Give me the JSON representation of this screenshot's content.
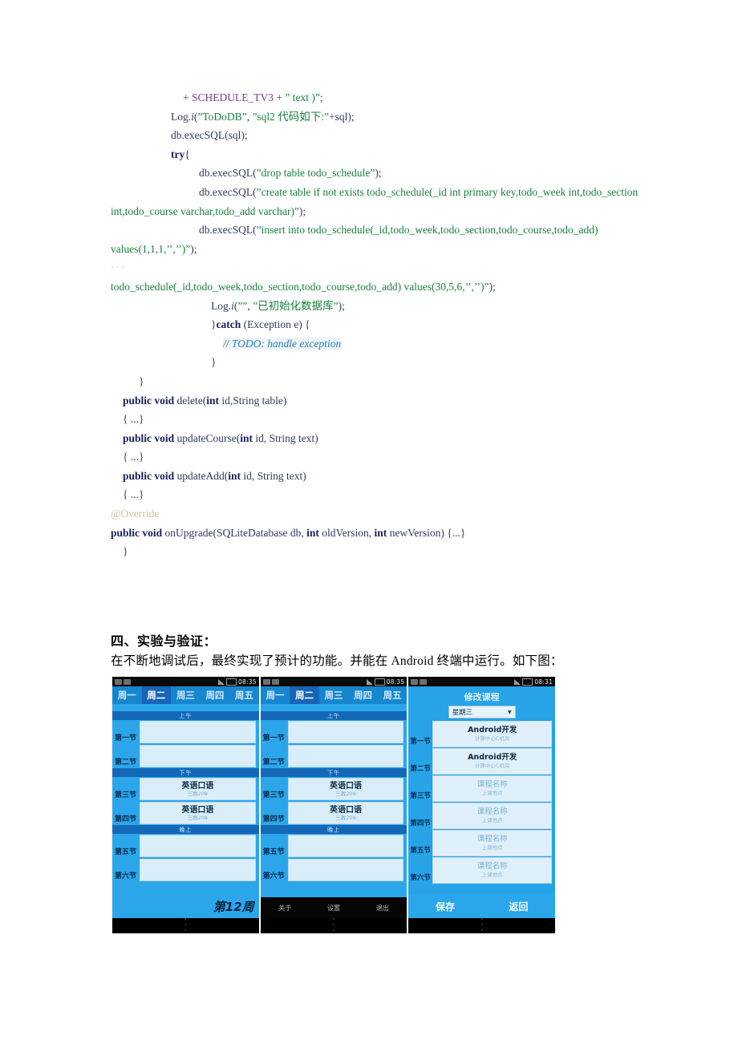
{
  "document": {
    "code_lines": [
      {
        "indent": 90,
        "parts": [
          {
            "t": "+ ",
            "c": "pln"
          },
          {
            "t": "SCHEDULE_TV3",
            "c": "cls"
          },
          {
            "t": " + ",
            "c": "pln"
          },
          {
            "t": "” text )”",
            "c": "str"
          },
          {
            "t": ";",
            "c": "pln"
          }
        ]
      },
      {
        "indent": 75,
        "parts": [
          {
            "t": "Log.",
            "c": "pln"
          },
          {
            "t": "i",
            "c": "mtd"
          },
          {
            "t": "(",
            "c": "pln"
          },
          {
            "t": "”ToDoDB”",
            "c": "str"
          },
          {
            "t": ", ",
            "c": "pln"
          },
          {
            "t": "”sql2 代码如下:”",
            "c": "str"
          },
          {
            "t": "+sql);",
            "c": "pln"
          }
        ]
      },
      {
        "indent": 75,
        "parts": [
          {
            "t": "db.execSQL(sql);",
            "c": "pln"
          }
        ]
      },
      {
        "indent": 75,
        "parts": [
          {
            "t": "try",
            "c": "kw"
          },
          {
            "t": "{",
            "c": "pln"
          }
        ]
      },
      {
        "indent": 110,
        "parts": [
          {
            "t": "db.execSQL(",
            "c": "pln"
          },
          {
            "t": "”drop table todo_schedule”",
            "c": "str"
          },
          {
            "t": ");",
            "c": "pln"
          }
        ]
      },
      {
        "indent": 110,
        "parts": [
          {
            "t": "db.execSQL(",
            "c": "pln"
          },
          {
            "t": "”create table if not exists todo_schedule(_id int primary key,todo_week int,todo_section int,todo_course varchar,todo_add varchar)”",
            "c": "str"
          },
          {
            "t": ");",
            "c": "pln"
          }
        ]
      },
      {
        "indent": 110,
        "parts": [
          {
            "t": "db.execSQL(",
            "c": "pln"
          },
          {
            "t": "”insert into todo_schedule(_id,todo_week,todo_section,todo_course,todo_add) values(1,1,1,’’,’’)”",
            "c": "str"
          },
          {
            "t": ");",
            "c": "pln"
          }
        ]
      },
      {
        "indent": 0,
        "parts": [
          {
            "t": "···",
            "c": "dots"
          }
        ]
      },
      {
        "indent": 0,
        "parts": [
          {
            "t": "todo_schedule(_id,todo_week,todo_section,todo_course,todo_add) values(30,5,6,’’,’’)”",
            "c": "str"
          },
          {
            "t": ");",
            "c": "pln"
          }
        ]
      },
      {
        "indent": 125,
        "parts": [
          {
            "t": "Log.",
            "c": "pln"
          },
          {
            "t": "i",
            "c": "mtd"
          },
          {
            "t": "(",
            "c": "pln"
          },
          {
            "t": "””",
            "c": "str"
          },
          {
            "t": ", ",
            "c": "pln"
          },
          {
            "t": "”已初始化数据库”",
            "c": "str"
          },
          {
            "t": ");",
            "c": "pln"
          }
        ]
      },
      {
        "indent": 125,
        "parts": [
          {
            "t": "}",
            "c": "pln"
          },
          {
            "t": "catch",
            "c": "kw"
          },
          {
            "t": " (Exception e) {",
            "c": "pln"
          }
        ]
      },
      {
        "indent": 140,
        "parts": [
          {
            "t": "// TODO: handle exception",
            "c": "cmt"
          }
        ]
      },
      {
        "indent": 125,
        "parts": [
          {
            "t": "}",
            "c": "pln"
          }
        ]
      },
      {
        "indent": 35,
        "parts": [
          {
            "t": "}",
            "c": "pln"
          }
        ]
      },
      {
        "indent": 15,
        "parts": [
          {
            "t": "public void",
            "c": "kw"
          },
          {
            "t": " delete(",
            "c": "pln"
          },
          {
            "t": "int",
            "c": "kw"
          },
          {
            "t": " id,String table)",
            "c": "pln"
          }
        ]
      },
      {
        "indent": 15,
        "parts": [
          {
            "t": "{ ...}",
            "c": "pln"
          }
        ]
      },
      {
        "indent": 15,
        "parts": [
          {
            "t": "public void",
            "c": "kw"
          },
          {
            "t": " updateCourse(",
            "c": "pln"
          },
          {
            "t": "int",
            "c": "kw"
          },
          {
            "t": " id, String text)",
            "c": "pln"
          }
        ]
      },
      {
        "indent": 15,
        "parts": [
          {
            "t": "{ ...}",
            "c": "pln"
          }
        ]
      },
      {
        "indent": 15,
        "parts": [
          {
            "t": "public void",
            "c": "kw"
          },
          {
            "t": " updateAdd(",
            "c": "pln"
          },
          {
            "t": "int",
            "c": "kw"
          },
          {
            "t": " id, String text)",
            "c": "pln"
          }
        ]
      },
      {
        "indent": 15,
        "parts": [
          {
            "t": "{ ...}",
            "c": "pln"
          }
        ]
      },
      {
        "indent": 0,
        "parts": [
          {
            "t": "@Override",
            "c": "ann"
          }
        ]
      },
      {
        "indent": 0,
        "parts": [
          {
            "t": "public void",
            "c": "kw"
          },
          {
            "t": " onUpgrade(SQLiteDatabase db, ",
            "c": "pln"
          },
          {
            "t": "int",
            "c": "kw"
          },
          {
            "t": " oldVersion, ",
            "c": "pln"
          },
          {
            "t": "int",
            "c": "kw"
          },
          {
            "t": " newVersion) {...}",
            "c": "pln"
          }
        ]
      },
      {
        "indent": 15,
        "parts": [
          {
            "t": "}",
            "c": "pln"
          }
        ]
      }
    ],
    "section_heading": "四、实验与验证：",
    "body_paragraph": "在不断地调试后，最终实现了预计的功能。并能在 Android 终端中运行。如下图："
  },
  "screenshots": {
    "phone1": {
      "status_time": "08:35",
      "tabs": [
        {
          "label": "周一",
          "active": false
        },
        {
          "label": "周二",
          "active": true
        },
        {
          "label": "周三",
          "active": false
        },
        {
          "label": "周四",
          "active": false
        },
        {
          "label": "周五",
          "active": false
        }
      ],
      "periods": [
        {
          "header": "上午",
          "slots": [
            {
              "label": "第一节",
              "course": "",
              "place": ""
            },
            {
              "label": "第二节",
              "course": "",
              "place": ""
            }
          ]
        },
        {
          "header": "下午",
          "slots": [
            {
              "label": "第三节",
              "course": "英语口语",
              "place": "三教209"
            },
            {
              "label": "第四节",
              "course": "英语口语",
              "place": "三教209"
            }
          ]
        },
        {
          "header": "晚上",
          "slots": [
            {
              "label": "第五节",
              "course": "",
              "place": ""
            },
            {
              "label": "第六节",
              "course": "",
              "place": ""
            }
          ]
        }
      ],
      "week_label": "第12周"
    },
    "phone2": {
      "status_time": "08:35",
      "tabs": [
        {
          "label": "周一",
          "active": false
        },
        {
          "label": "周二",
          "active": true
        },
        {
          "label": "周三",
          "active": false
        },
        {
          "label": "周四",
          "active": false
        },
        {
          "label": "周五",
          "active": false
        }
      ],
      "periods": [
        {
          "header": "上午",
          "slots": [
            {
              "label": "第一节",
              "course": "",
              "place": ""
            },
            {
              "label": "第二节",
              "course": "",
              "place": ""
            }
          ]
        },
        {
          "header": "下午",
          "slots": [
            {
              "label": "第三节",
              "course": "英语口语",
              "place": "三教209"
            },
            {
              "label": "第四节",
              "course": "英语口语",
              "place": "三教209"
            }
          ]
        },
        {
          "header": "晚上",
          "slots": [
            {
              "label": "第五节",
              "course": "",
              "place": ""
            },
            {
              "label": "第六节",
              "course": "",
              "place": ""
            }
          ]
        }
      ],
      "menu": [
        {
          "label": "关于"
        },
        {
          "label": "设置"
        },
        {
          "label": "退出"
        }
      ]
    },
    "phone3": {
      "status_time": "08:31",
      "title": "修改课程",
      "day_selected": "星期三",
      "rows": [
        {
          "label": "第一节",
          "course": "Android开发",
          "place": "计算中心C机房",
          "placeholder": false
        },
        {
          "label": "第二节",
          "course": "Android开发",
          "place": "计算中心C机房",
          "placeholder": false
        },
        {
          "label": "第三节",
          "course": "课程名称",
          "place": "上课地点",
          "placeholder": true
        },
        {
          "label": "第四节",
          "course": "课程名称",
          "place": "上课地点",
          "placeholder": true
        },
        {
          "label": "第五节",
          "course": "课程名称",
          "place": "上课地点",
          "placeholder": true
        },
        {
          "label": "第六节",
          "course": "课程名称",
          "place": "上课地点",
          "placeholder": true
        }
      ],
      "buttons": [
        {
          "label": "保存"
        },
        {
          "label": "返回"
        }
      ]
    }
  },
  "colors": {
    "accent_blue": "#2ca6ea",
    "tab_bar": "#1686cf",
    "tab_active": "#1666b8",
    "card": "#d9eef8",
    "keyword": "#16205a",
    "string": "#15803a",
    "class_name": "#7d3c8e",
    "comment": "#2b7fb5",
    "annotation": "#cdc49a"
  }
}
